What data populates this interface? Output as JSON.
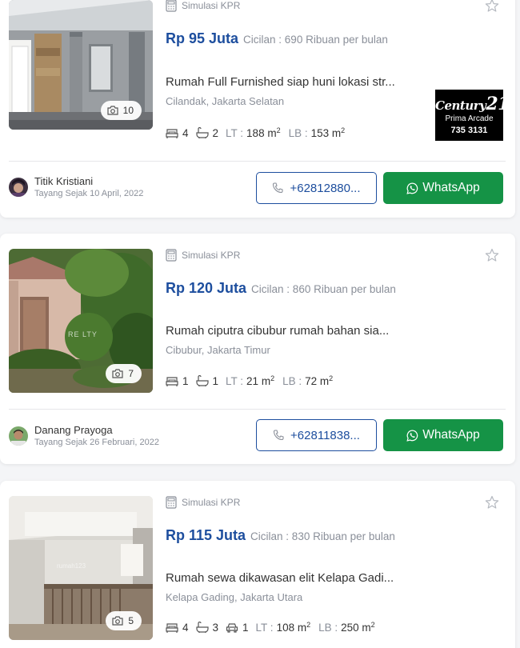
{
  "colors": {
    "price": "#1d4e9e",
    "whatsapp": "#159346",
    "muted": "#8a8f99"
  },
  "listings": [
    {
      "photo_count": "10",
      "kpr_label": "Simulasi KPR",
      "price": "Rp 95 Juta",
      "cicilan": "Cicilan : 690 Ribuan per bulan",
      "title": "Rumah Full Furnished siap huni lokasi str...",
      "location": "Cilandak, Jakarta Selatan",
      "bedrooms": "4",
      "bathrooms": "2",
      "lt_label": "LT :",
      "lt_value": "188 m",
      "lb_label": "LB :",
      "lb_value": "153 m",
      "agency": {
        "brand": "Century",
        "brand_num": "21",
        "branch": "Prima Arcade",
        "phone": "735 3131"
      },
      "agent_name": "Titik Kristiani",
      "agent_since": "Tayang Sejak 10 April, 2022",
      "phone_button": "+62812880...",
      "whatsapp_button": "WhatsApp"
    },
    {
      "photo_count": "7",
      "kpr_label": "Simulasi KPR",
      "price": "Rp 120 Juta",
      "cicilan": "Cicilan : 860 Ribuan per bulan",
      "title": "Rumah ciputra cibubur rumah bahan sia...",
      "location": "Cibubur, Jakarta Timur",
      "bedrooms": "1",
      "bathrooms": "1",
      "lt_label": "LT :",
      "lt_value": "21 m",
      "lb_label": "LB :",
      "lb_value": "72 m",
      "agent_name": "Danang Prayoga",
      "agent_since": "Tayang Sejak 26 Februari, 2022",
      "phone_button": "+62811838...",
      "whatsapp_button": "WhatsApp"
    },
    {
      "photo_count": "5",
      "kpr_label": "Simulasi KPR",
      "price": "Rp 115 Juta",
      "cicilan": "Cicilan : 830 Ribuan per bulan",
      "title": "Rumah sewa dikawasan elit Kelapa Gadi...",
      "location": "Kelapa Gading, Jakarta Utara",
      "bedrooms": "4",
      "bathrooms": "3",
      "garage": "1",
      "lt_label": "LT :",
      "lt_value": "108 m",
      "lb_label": "LB :",
      "lb_value": "250 m"
    }
  ]
}
